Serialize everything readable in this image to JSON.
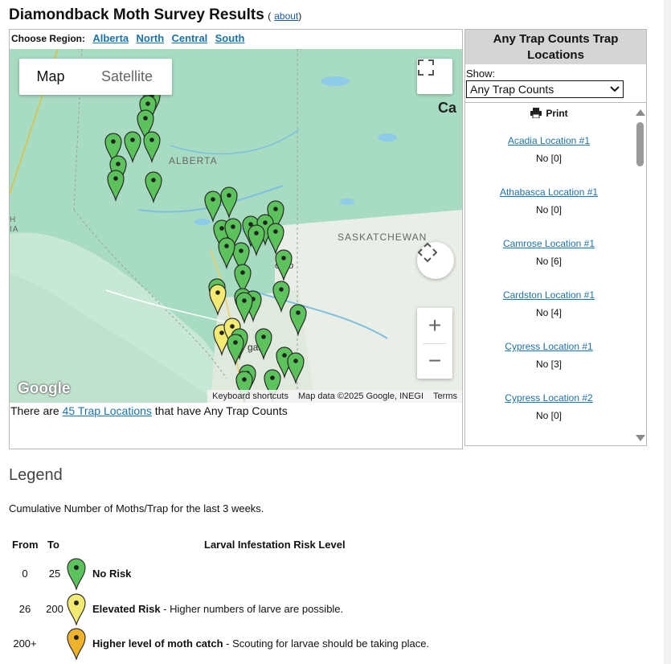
{
  "page": {
    "title": "Diamondback Moth Survey Results",
    "about_label": "about"
  },
  "region": {
    "label": "Choose Region:",
    "links": [
      "Alberta",
      "North",
      "Central",
      "South"
    ]
  },
  "map": {
    "type_map": "Map",
    "type_satellite": "Satellite",
    "labels": {
      "alberta": "ALBERTA",
      "saskatchewan": "SASKATCHEWAN",
      "can": "Ca",
      "calgary": "gary",
      "edmonton": "onto",
      "left_h": "H",
      "left_ia": "IA"
    },
    "attribution": [
      "Keyboard shortcuts",
      "Map data ©2025 Google, INEGI",
      "Terms"
    ],
    "google": "Google"
  },
  "summary": {
    "prefix": "There are ",
    "link": "45 Trap Locations",
    "suffix": " that have Any Trap Counts"
  },
  "side": {
    "heading": "Any Trap Counts Trap Locations",
    "show_label": "Show:",
    "select_value": "Any Trap Counts",
    "print_label": "Print",
    "locations": [
      {
        "name": "Acadia Location #1",
        "value": "No [0]"
      },
      {
        "name": "Athabasca Location #1",
        "value": "No [0]"
      },
      {
        "name": "Camrose Location #1",
        "value": "No [6]"
      },
      {
        "name": "Cardston Location #1",
        "value": "No [4]"
      },
      {
        "name": "Cypress Location #1",
        "value": "No [3]"
      },
      {
        "name": "Cypress Location #2",
        "value": "No [0]"
      }
    ]
  },
  "legend": {
    "title": "Legend",
    "description": "Cumulative Number of Moths/Trap for the last 3 weeks.",
    "headers": {
      "from": "From",
      "to": "To",
      "risk": "Larval Infestation Risk Level"
    },
    "rows": [
      {
        "from": "0",
        "to": "25",
        "label": "No Risk",
        "detail": "",
        "color": "#5cc25c"
      },
      {
        "from": "26",
        "to": "200",
        "label": "Elevated Risk",
        "detail": " - Higher numbers of larve are possible.",
        "color": "#f3ea72"
      },
      {
        "from": "200+",
        "to": "",
        "label": "Higher level of moth catch",
        "detail": " - Scouting for larvae should be taking place.",
        "color": "#f0b42c"
      }
    ]
  },
  "colors": {
    "green_pin": "#5cc25c",
    "yellow_pin": "#f3ea72",
    "orange_pin": "#f0b42c",
    "link": "#1b73a8"
  }
}
